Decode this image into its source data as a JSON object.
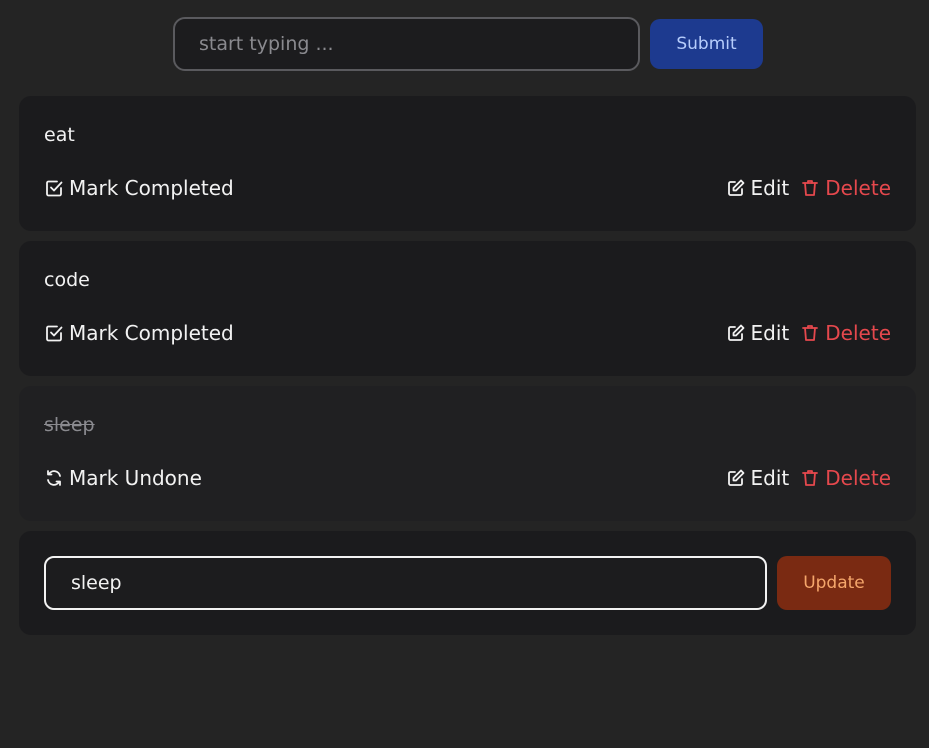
{
  "new_todo": {
    "placeholder": "start typing ...",
    "value": "",
    "submit_label": "Submit"
  },
  "todos": [
    {
      "title": "eat",
      "completed": false,
      "toggle_label": "Mark Completed",
      "toggle_icon": "check-square-icon",
      "edit_label": "Edit",
      "delete_label": "Delete"
    },
    {
      "title": "code",
      "completed": false,
      "toggle_label": "Mark Completed",
      "toggle_icon": "check-square-icon",
      "edit_label": "Edit",
      "delete_label": "Delete"
    },
    {
      "title": "sleep",
      "completed": true,
      "toggle_label": "Mark Undone",
      "toggle_icon": "refresh-icon",
      "edit_label": "Edit",
      "delete_label": "Delete"
    }
  ],
  "editor": {
    "value": "sleep",
    "update_label": "Update"
  },
  "colors": {
    "background": "#242424",
    "card": "#1b1b1d",
    "submit_bg": "#1d3a8f",
    "update_bg": "#7a2a12",
    "delete": "#e5484d"
  }
}
